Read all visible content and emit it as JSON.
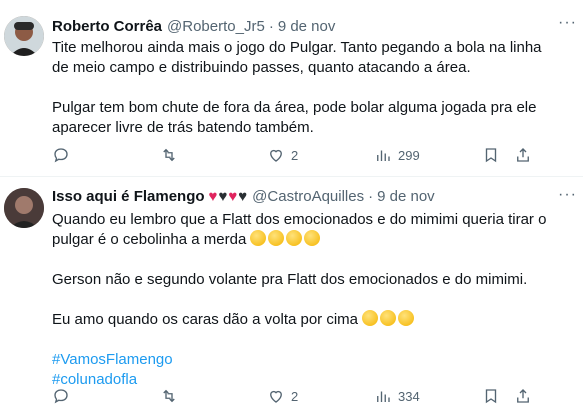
{
  "tweets": [
    {
      "name": "Roberto Corrêa",
      "handle": "@Roberto_Jr5",
      "separator": "·",
      "date": "9 de nov",
      "lines": [
        "Tite melhorou ainda mais o jogo do Pulgar. Tanto pegando a bola na linha",
        "de meio campo e distribuindo passes, quanto atacando a área.",
        "",
        "Pulgar tem bom chute de fora da área, pode bolar alguma jogada pra ele",
        "aparecer livre de trás batendo também."
      ],
      "likes": "2",
      "views": "299"
    },
    {
      "name": "Isso aqui é Flamengo",
      "handle": "@CastroAquilles",
      "separator": "·",
      "date": "9 de nov",
      "lines": [
        "Quando eu lembro que a Flatt dos emocionados e do mimimi queria tirar o",
        "pulgar é o cebolinha a merda",
        "",
        "Gerson não e segundo volante pra Flatt dos emocionados e do mimimi.",
        "",
        "Eu amo quando os caras dão a volta por cima"
      ],
      "hashtags": [
        "#VamosFlamengo",
        "#colunadofla"
      ],
      "likes": "2",
      "views": "334"
    }
  ],
  "colors": {
    "heart_red": "#e0245e",
    "heart_black": "#292f33",
    "link": "#1d9bf0",
    "muted": "#536471"
  },
  "icons": [
    "reply-icon",
    "retweet-icon",
    "like-icon",
    "views-icon",
    "bookmark-icon",
    "share-icon",
    "more-icon"
  ],
  "more_label": "···"
}
